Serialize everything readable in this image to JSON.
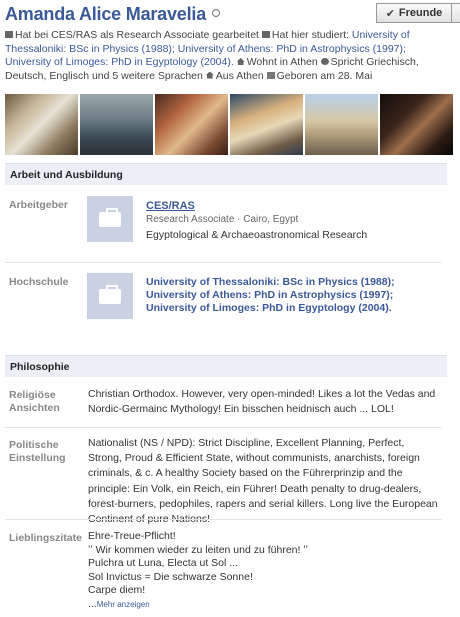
{
  "profile": {
    "name": "Amanda Alice Maravelia",
    "friends_button": "Freunde"
  },
  "info": {
    "work_prefix": "Hat bei CES/RAS als Research Associate gearbeitet",
    "study_prefix": "Hat hier studiert:",
    "study_text": "University of Thessaloniki: BSc in Physics (1988); University of Athens: PhD in Astrophysics (1997); University of Limoges: PhD in Egyptology (2004).",
    "lives": "Wohnt in Athen",
    "languages": "Spricht Griechisch, Deutsch, Englisch und 5 weitere Sprachen",
    "from": "Aus Athen",
    "born": "Geboren am 28. Mai"
  },
  "sections": {
    "work_education": "Arbeit und Ausbildung",
    "philosophy": "Philosophie"
  },
  "work": {
    "employer_label": "Arbeitgeber",
    "employer_name": "CES/RAS",
    "employer_role": "Research Associate · Cairo, Egypt",
    "employer_desc": "Egyptological & Archaeoastronomical Research"
  },
  "education": {
    "label": "Hochschule",
    "schools": [
      "University of Thessaloniki: BSc in Physics (1988);",
      "University of Athens: PhD in Astrophysics (1997);",
      "University of Limoges: PhD in Egyptology (2004)."
    ]
  },
  "philosophy": {
    "religious_label_1": "Religiöse",
    "religious_label_2": "Ansichten",
    "religious_text": "Christian Orthodox. However, very open-minded! Likes a lot the Vedas and Nordic-Germainc Mythology! Ein bisschen heidnisch auch ... LOL!",
    "political_label_1": "Politische",
    "political_label_2": "Einstellung",
    "political_text": "Nationalist (NS / NPD): Strict Discipline, Excellent Planning, Perfect, Strong, Proud & Efficient State, without communists, anarchists, foreign criminals, & c. A healthy Society based on the Führerprinzip and the principle: Ein Volk, ein Reich, ein Führer! Death penalty to drug-dealers, forest-burners, pedophiles, rapers and serial killers. Long live the European Continent of pure Nations!",
    "quotes_label": "Lieblingszitate",
    "quotes": [
      "Ehre-Treue-Pflicht!",
      "ʼʼ Wir kommen wieder zu leiten und zu führen! ʼʼ",
      "Pulchra ut Luna, Electa ut Sol ...",
      "Sol Invictus = Die schwarze Sonne!",
      "Carpe diem!"
    ],
    "more_prefix": "...",
    "more_link": "Mehr anzeigen"
  },
  "icons": {
    "work": "briefcase-icon",
    "study": "graduation-cap-icon",
    "lives": "house-icon",
    "languages": "speech-bubble-icon",
    "from": "house-icon",
    "born": "calendar-icon",
    "visibility": "globe-icon"
  },
  "colors": {
    "link": "#3b5998",
    "section_bg": "#eceff5",
    "label": "#888888"
  }
}
